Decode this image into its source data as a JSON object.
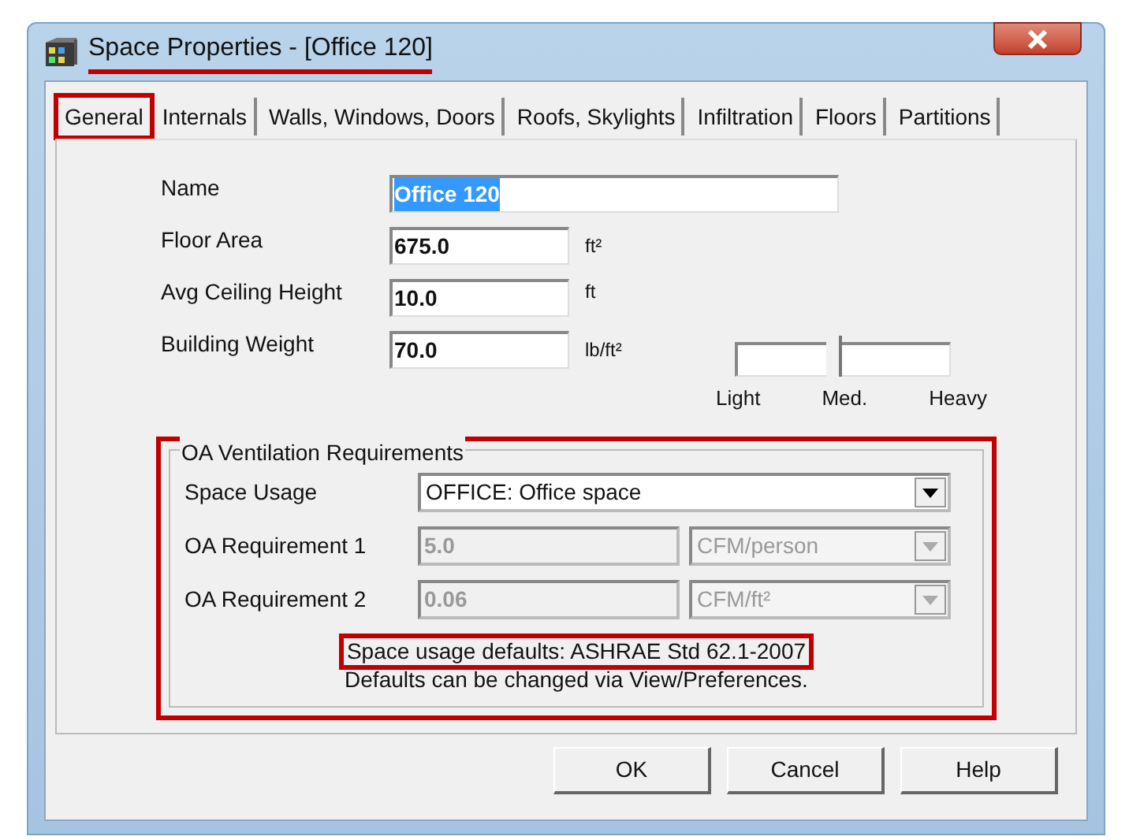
{
  "window": {
    "title": "Space Properties - [Office 120]",
    "title_highlighted": true
  },
  "tabs": [
    {
      "label": "General",
      "selected": true,
      "highlighted": true
    },
    {
      "label": "Internals",
      "selected": false,
      "highlighted": false
    },
    {
      "label": "Walls, Windows, Doors",
      "selected": false,
      "highlighted": false
    },
    {
      "label": "Roofs, Skylights",
      "selected": false,
      "highlighted": false
    },
    {
      "label": "Infiltration",
      "selected": false,
      "highlighted": false
    },
    {
      "label": "Floors",
      "selected": false,
      "highlighted": false
    },
    {
      "label": "Partitions",
      "selected": false,
      "highlighted": false
    }
  ],
  "fields": [
    {
      "label": "Name",
      "value": "Office 120",
      "text_selected": true
    },
    {
      "label": "Floor Area",
      "value": "675.0",
      "unit": "ft²",
      "text_selected": false
    },
    {
      "label": "Avg Ceiling Height",
      "value": "10.0",
      "unit": "ft",
      "text_selected": false
    },
    {
      "label": "Building Weight",
      "value": "70.0",
      "unit": "lb/ft²",
      "text_selected": false
    }
  ],
  "weight_slider": {
    "level": 0.45,
    "labels": [
      "Light",
      "Med.",
      "Heavy"
    ]
  },
  "oa_group": {
    "title": "OA Ventilation Requirements",
    "highlighted": true,
    "space_usage": {
      "label": "Space Usage",
      "value": "OFFICE: Office space",
      "disabled": false
    },
    "requirements": [
      {
        "label": "OA Requirement 1",
        "value": "5.0",
        "unit": "CFM/person",
        "disabled": true
      },
      {
        "label": "OA Requirement 2",
        "value": "0.06",
        "unit": "CFM/ft²",
        "disabled": true
      }
    ],
    "note": {
      "text": "Space usage defaults: ASHRAE Std 62.1-2007",
      "highlighted": true
    },
    "hint": "Defaults can be changed via View/Preferences."
  },
  "buttons": [
    "OK",
    "Cancel",
    "Help"
  ]
}
